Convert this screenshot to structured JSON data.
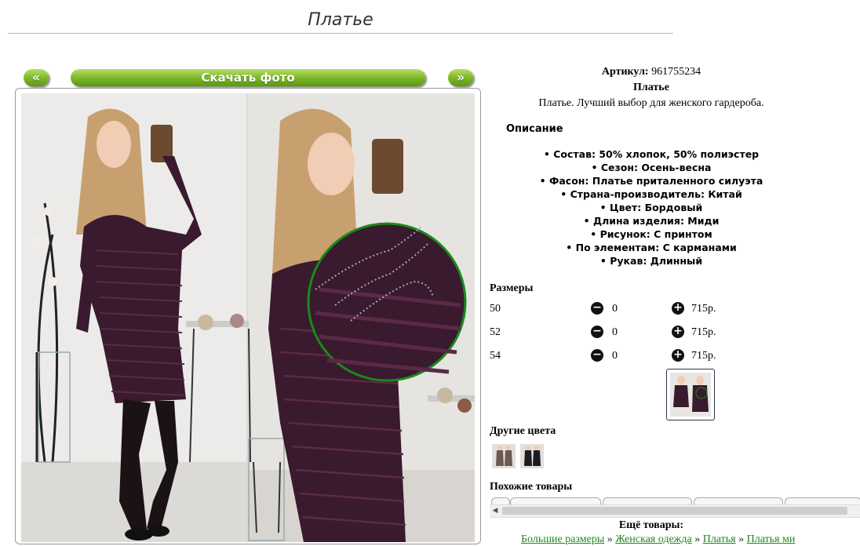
{
  "page": {
    "title": "Платье"
  },
  "gallery": {
    "prev_label": "«",
    "download_label": "Скачать фото",
    "next_label": "»"
  },
  "product": {
    "article_label": "Артикул:",
    "article": "961755234",
    "name": "Платье",
    "subtitle": "Платье. Лучший выбор для женского гардероба.",
    "description_heading": "Описание",
    "attributes": [
      "Состав: 50% хлопок, 50% полиэстер",
      "Сезон: Осень-весна",
      "Фасон: Платье приталенного силуэта",
      "Страна-производитель: Китай",
      "Цвет: Бордовый",
      "Длина изделия: Миди",
      "Рисунок: С принтом",
      "По элементам: С карманами",
      "Рукав: Длинный"
    ]
  },
  "sizes": {
    "heading": "Размеры",
    "rows": [
      {
        "size": "50",
        "qty": "0",
        "price": "715р."
      },
      {
        "size": "52",
        "qty": "0",
        "price": "715р."
      },
      {
        "size": "54",
        "qty": "0",
        "price": "715р."
      }
    ]
  },
  "other_colors": {
    "heading": "Другие цвета"
  },
  "similar": {
    "heading": "Похожие товары"
  },
  "more": {
    "heading": "Ещё товары:",
    "breadcrumbs": [
      "Большие размеры",
      "Женская одежда",
      "Платья",
      "Платья ми"
    ],
    "separator": " » "
  },
  "icons": {
    "minus": "minus-circle-icon",
    "plus": "plus-circle-icon",
    "scroll_left": "arrow-left-icon"
  },
  "colors": {
    "button_green": "#7fb82a",
    "link_green": "#1a8a1a",
    "dress": "#3a1a2e",
    "zoom_ring": "#1a8a1a"
  }
}
